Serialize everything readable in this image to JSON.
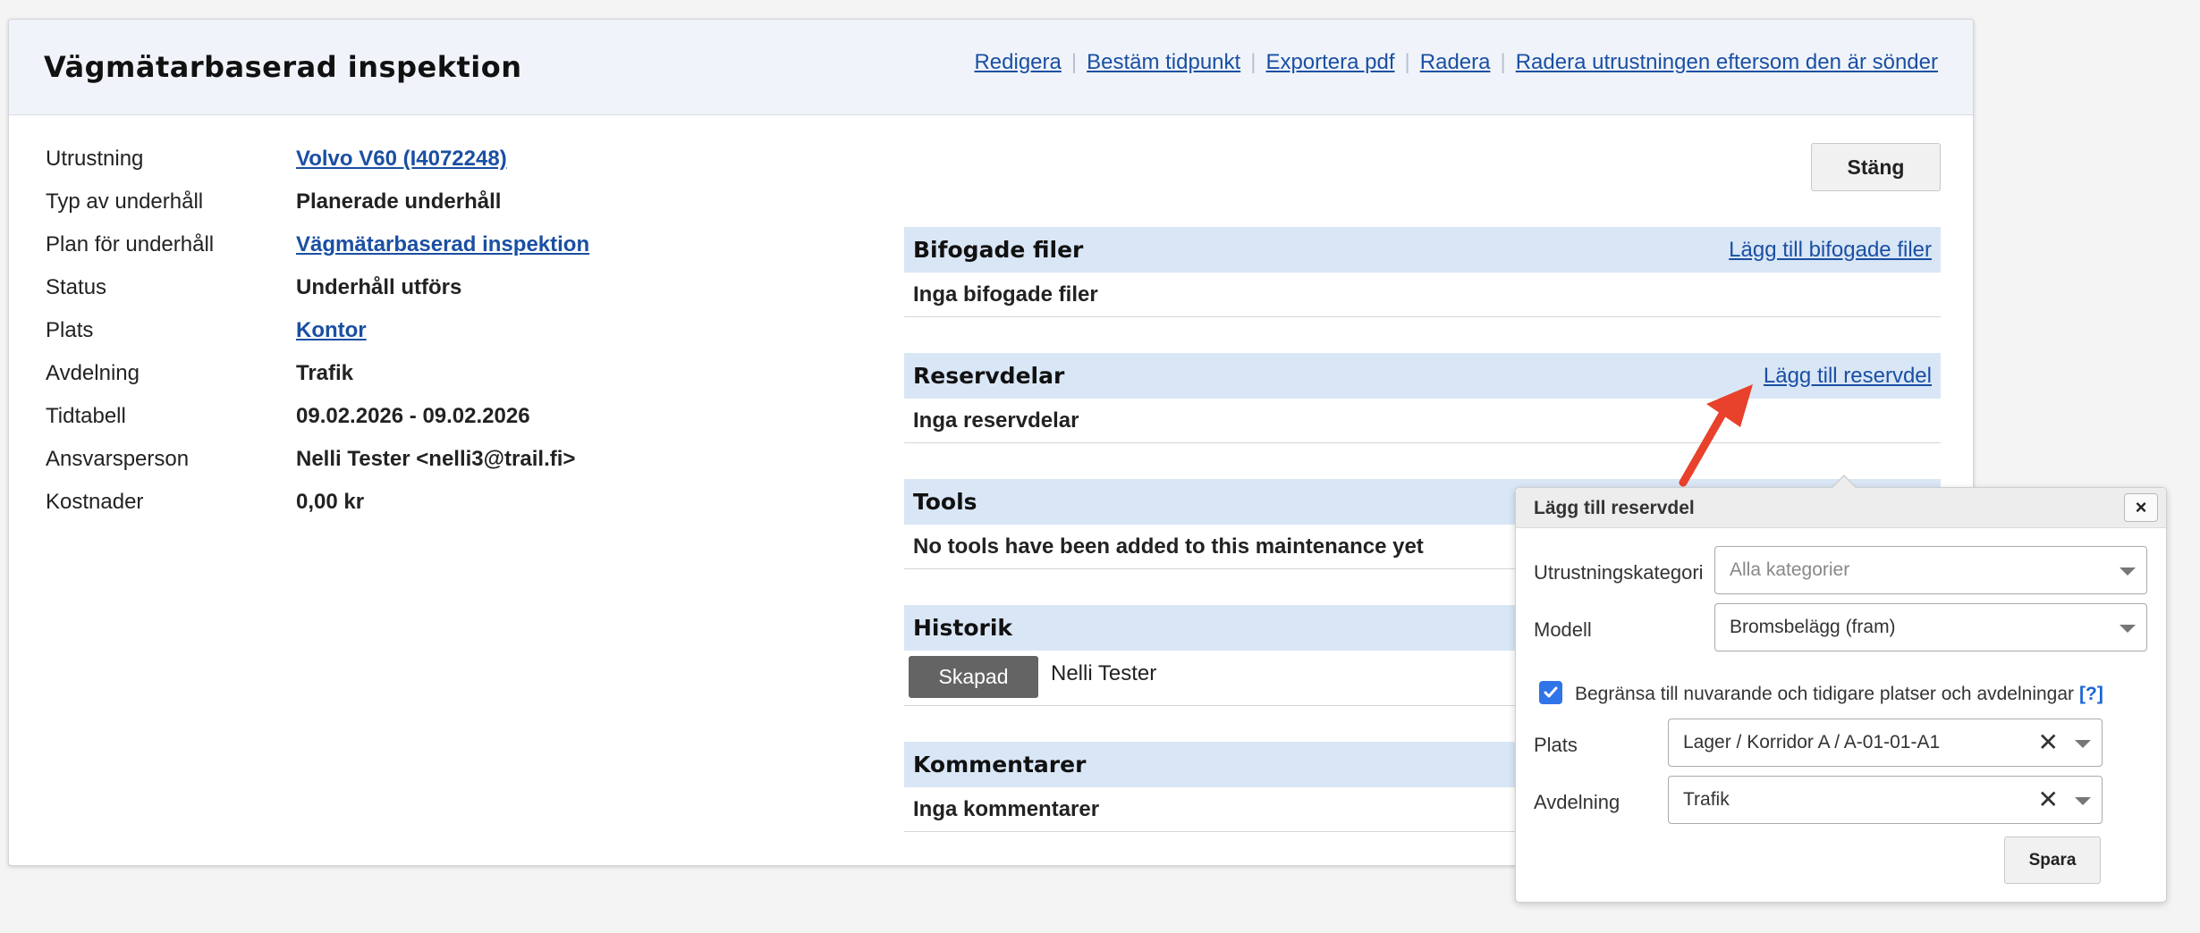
{
  "page": {
    "title": "Vägmätarbaserad inspektion",
    "actions": [
      "Redigera",
      "Bestäm tidpunkt",
      "Exportera pdf",
      "Radera",
      "Radera utrustningen eftersom den är sönder"
    ],
    "close_label": "Stäng"
  },
  "details": [
    {
      "label": "Utrustning",
      "value": "Volvo V60 (I4072248)"
    },
    {
      "label": "Typ av underhåll",
      "value": "Planerade underhåll"
    },
    {
      "label": "Plan för underhåll",
      "value": "Vägmätarbaserad inspektion"
    },
    {
      "label": "Status",
      "value": "Underhåll utförs"
    },
    {
      "label": "Plats",
      "value": "Kontor"
    },
    {
      "label": "Avdelning",
      "value": "Trafik"
    },
    {
      "label": "Tidtabell",
      "value": "09.02.2026 - 09.02.2026"
    },
    {
      "label": "Ansvarsperson",
      "value": "Nelli Tester <nelli3@trail.fi>"
    },
    {
      "label": "Kostnader",
      "value": "0,00 kr"
    }
  ],
  "sections": {
    "attachments": {
      "title": "Bifogade filer",
      "link": "Lägg till bifogade filer",
      "empty": "Inga bifogade filer"
    },
    "spare_parts": {
      "title": "Reservdelar",
      "link": "Lägg till reservdel",
      "empty": "Inga reservdelar"
    },
    "tools": {
      "title": "Tools",
      "empty": "No tools have been added to this maintenance yet"
    },
    "history": {
      "title": "Historik",
      "badge": "Skapad",
      "user": "Nelli Tester"
    },
    "comments": {
      "title": "Kommentarer",
      "empty": "Inga kommentarer"
    }
  },
  "popup": {
    "title": "Lägg till reservdel",
    "close_symbol": "×",
    "category_label": "Utrustningskategori",
    "category_placeholder": "Alla kategorier",
    "model_label": "Modell",
    "model_value": "Bromsbelägg (fram)",
    "restrict_label": "Begränsa till nuvarande och tidigare platser och avdelningar",
    "restrict_checked": true,
    "help_link": "[?]",
    "location_label": "Plats",
    "location_value": "Lager / Korridor A / A-01-01-A1",
    "department_label": "Avdelning",
    "department_value": "Trafik",
    "clear_symbol": "✕",
    "save_label": "Spara"
  },
  "colors": {
    "link": "#1a4fa3",
    "section_header_bg": "#d9e6f6",
    "header_bg": "#f0f4fa",
    "badge_bg": "#646464",
    "checkbox": "#2f74e8",
    "arrow": "#e8412c"
  }
}
